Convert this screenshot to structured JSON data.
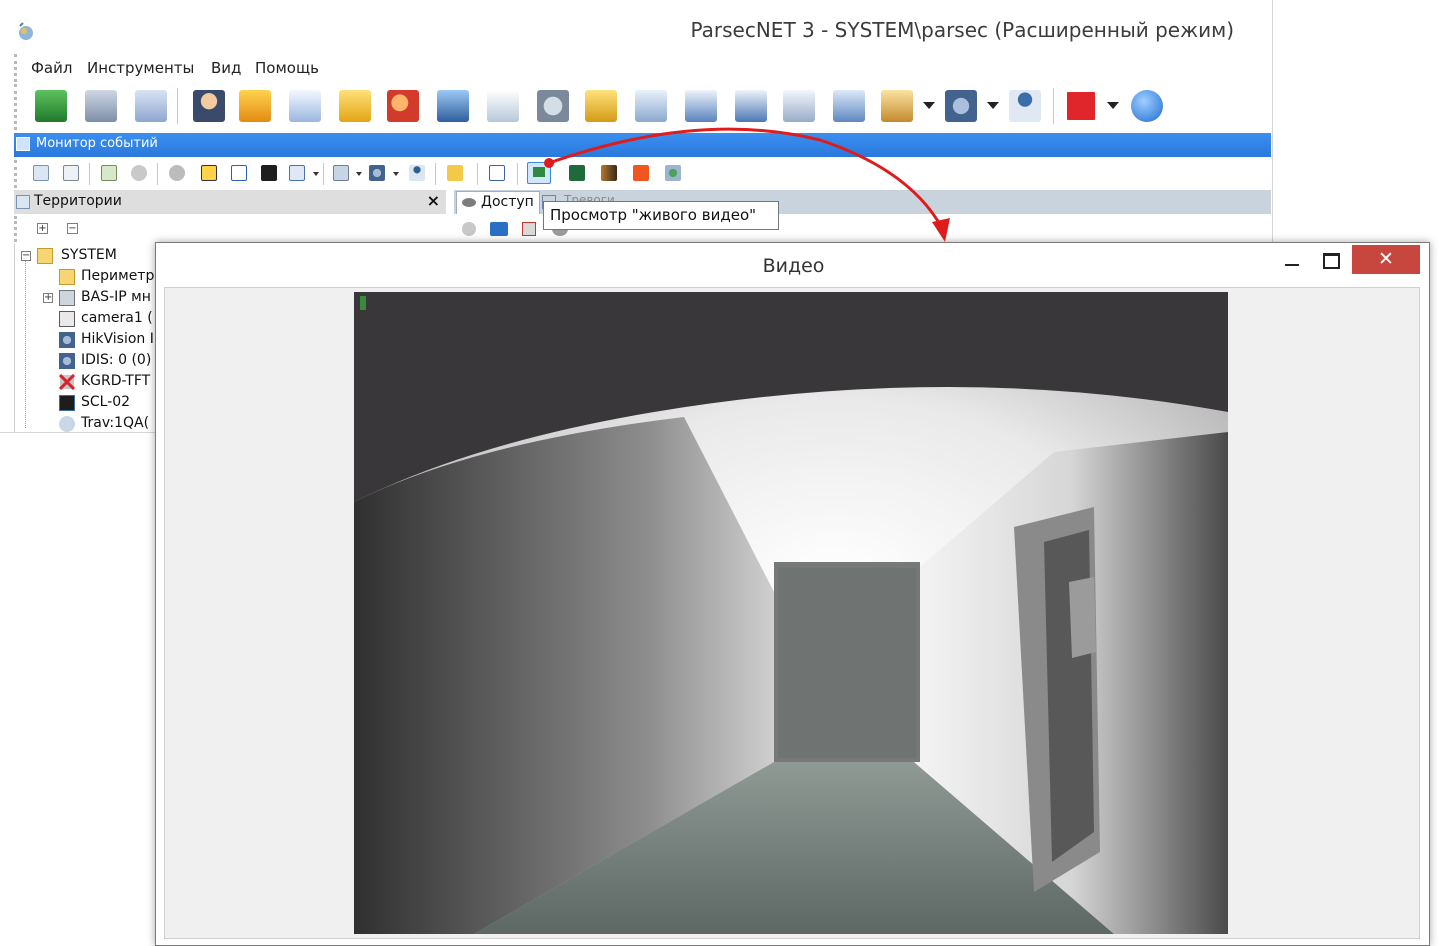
{
  "app": {
    "title": "ParsecNET 3 - SYSTEM\\parsec (Расширенный режим)"
  },
  "menu": {
    "items": [
      "Файл",
      "Инструменты",
      "Вид",
      "Помощь"
    ]
  },
  "monitor_panel": {
    "title": "Монитор событий"
  },
  "territory_panel": {
    "title": "Территории",
    "close": "×",
    "expand": "+",
    "collapse": "−"
  },
  "tabs": {
    "access": "Доступ",
    "alarms": "Тревоги"
  },
  "tooltip": {
    "text": "Просмотр \"живого видео\""
  },
  "tree": {
    "root": "SYSTEM",
    "items": [
      "Периметр",
      "BAS-IP мн",
      "camera1 (",
      "HikVision I",
      "IDIS: 0 (0)",
      "KGRD-TFT",
      "SCL-02",
      "Trav:1QA("
    ]
  },
  "video_window": {
    "title": "Видео",
    "close": "✕"
  },
  "colors": {
    "accent": "#2a79dc",
    "close_button": "#c7463d",
    "annotation_arrow": "#e01b1b"
  }
}
